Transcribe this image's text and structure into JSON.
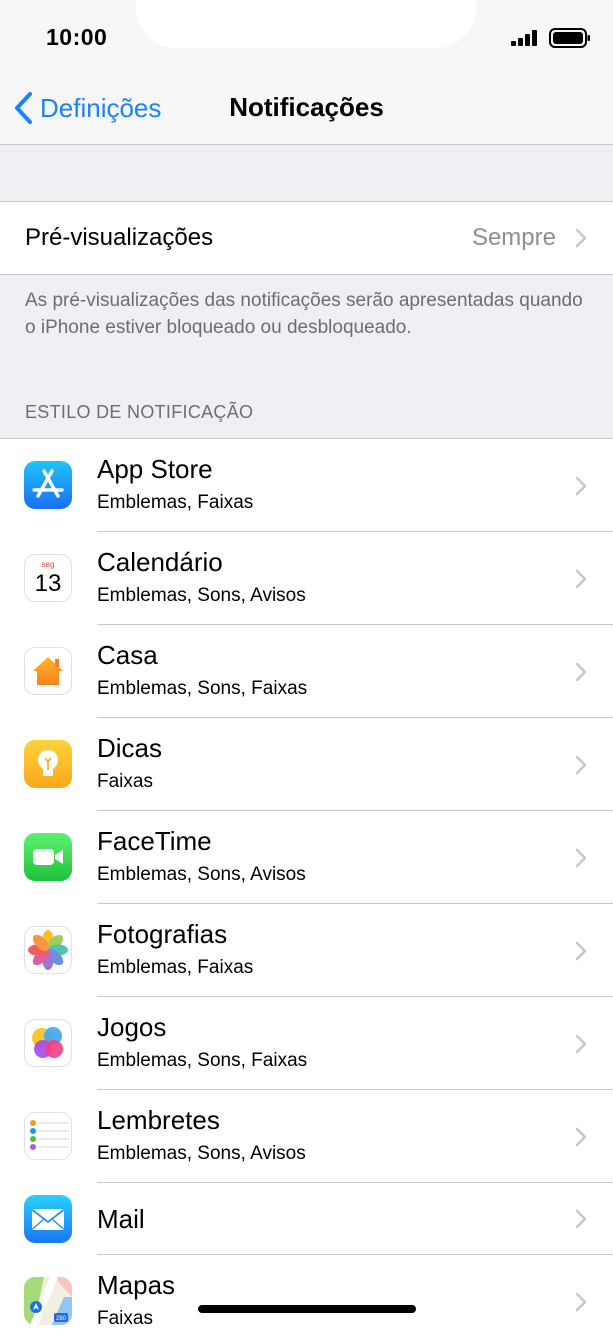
{
  "status": {
    "time": "10:00"
  },
  "nav": {
    "back_label": "Definições",
    "title": "Notificações"
  },
  "preview": {
    "label": "Pré-visualizações",
    "value": "Sempre",
    "footer": "As pré-visualizações das notificações serão apresentadas quando o iPhone estiver bloqueado ou desbloqueado."
  },
  "section": {
    "header": "ESTILO DE NOTIFICAÇÃO"
  },
  "apps": [
    {
      "name": "App Store",
      "sub": "Emblemas, Faixas",
      "icon": "app-store-icon"
    },
    {
      "name": "Calendário",
      "sub": "Emblemas, Sons, Avisos",
      "icon": "calendar-icon",
      "icon_day": "seg",
      "icon_date": "13"
    },
    {
      "name": "Casa",
      "sub": "Emblemas, Sons, Faixas",
      "icon": "home-icon"
    },
    {
      "name": "Dicas",
      "sub": "Faixas",
      "icon": "tips-icon"
    },
    {
      "name": "FaceTime",
      "sub": "Emblemas, Sons, Avisos",
      "icon": "facetime-icon"
    },
    {
      "name": "Fotografias",
      "sub": "Emblemas, Faixas",
      "icon": "photos-icon"
    },
    {
      "name": "Jogos",
      "sub": "Emblemas, Sons, Faixas",
      "icon": "game-center-icon"
    },
    {
      "name": "Lembretes",
      "sub": "Emblemas, Sons, Avisos",
      "icon": "reminders-icon"
    },
    {
      "name": "Mail",
      "sub": "",
      "icon": "mail-icon"
    },
    {
      "name": "Mapas",
      "sub": "Faixas",
      "icon": "maps-icon",
      "icon_badge": "280"
    }
  ],
  "colors": {
    "accent": "#1a82fb",
    "background": "#efeff4",
    "separator": "#c8c7cc",
    "secondary_text": "#8e8e93"
  }
}
